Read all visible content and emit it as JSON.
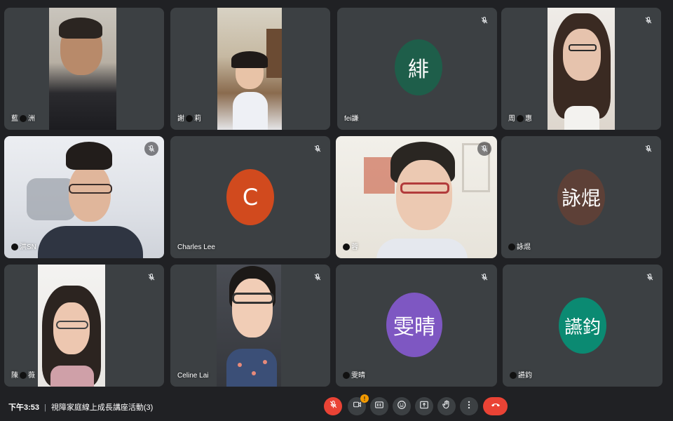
{
  "participants": [
    {
      "name_pre": "藍",
      "name_post": "洲"
    },
    {
      "name_pre": "謝",
      "name_post": "莉"
    },
    {
      "name": "fei謙",
      "initial": "緋",
      "color": "#1e5e4a"
    },
    {
      "name_pre": "周",
      "name_post": "惠"
    },
    {
      "name_pre": "",
      "name_post": "洪SN"
    },
    {
      "name": "Charles Lee",
      "initial": "C",
      "color": "#d14a1e"
    },
    {
      "name_pre": "",
      "name_post": "蓉"
    },
    {
      "name_pre": "",
      "name_post": "詠焜",
      "initial": "詠焜",
      "color": "#5d4037"
    },
    {
      "name_pre": "陳",
      "name_post": "薇"
    },
    {
      "name": "Celine Lai"
    },
    {
      "name_pre": "",
      "name_post": "雯晴",
      "initial": "雯晴",
      "color": "#7e57c2"
    },
    {
      "name_pre": "",
      "name_post": "讌鈞",
      "initial": "讌鈞",
      "color": "#0b8a72"
    }
  ],
  "meeting": {
    "time": "下午3:53",
    "separator": "|",
    "title": "視障家庭線上成長講座活動(3)"
  },
  "controls": {
    "mic": "mic-off-icon",
    "camera": "camera-icon",
    "camera_badge": "!",
    "captions": "captions-icon",
    "emoji": "emoji-icon",
    "present": "present-icon",
    "hand": "raise-hand-icon",
    "more": "more-options-icon",
    "hangup": "hangup-icon"
  }
}
